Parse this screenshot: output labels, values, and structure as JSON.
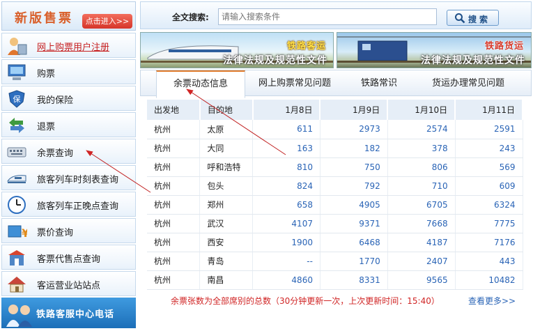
{
  "sidebar": {
    "header_title": "新版售票",
    "enter_label": "点击进入>>",
    "items": [
      {
        "label": "网上购票用户注册",
        "icon": "user-register-icon"
      },
      {
        "label": "购票",
        "icon": "computer-icon"
      },
      {
        "label": "我的保险",
        "icon": "shield-icon"
      },
      {
        "label": "退票",
        "icon": "return-arrow-icon"
      },
      {
        "label": "余票查询",
        "icon": "keyboard-icon"
      },
      {
        "label": "旅客列车时刻表查询",
        "icon": "train-icon"
      },
      {
        "label": "旅客列车正晚点查询",
        "icon": "clock-icon"
      },
      {
        "label": "票价查询",
        "icon": "price-icon"
      },
      {
        "label": "客票代售点查询",
        "icon": "store-icon"
      },
      {
        "label": "客运营业站站点",
        "icon": "house-icon"
      }
    ],
    "banner_text": "铁路客服中心电话"
  },
  "search": {
    "label": "全文搜索:",
    "placeholder": "请输入搜索条件",
    "button_label": "搜索"
  },
  "banners": [
    {
      "caption_top": "铁路客运",
      "caption_bottom": "法律法规及规范性文件"
    },
    {
      "caption_top": "铁路货运",
      "caption_bottom": "法律法规及规范性文件"
    }
  ],
  "tabs": [
    "余票动态信息",
    "网上购票常见问题",
    "铁路常识",
    "货运办理常见问题"
  ],
  "table": {
    "headers": [
      "出发地",
      "目的地",
      "1月8日",
      "1月9日",
      "1月10日",
      "1月11日"
    ],
    "rows": [
      [
        "杭州",
        "太原",
        "611",
        "2973",
        "2574",
        "2591"
      ],
      [
        "杭州",
        "大同",
        "163",
        "182",
        "378",
        "243"
      ],
      [
        "杭州",
        "呼和浩特",
        "810",
        "750",
        "806",
        "569"
      ],
      [
        "杭州",
        "包头",
        "824",
        "792",
        "710",
        "609"
      ],
      [
        "杭州",
        "郑州",
        "658",
        "4905",
        "6705",
        "6324"
      ],
      [
        "杭州",
        "武汉",
        "4107",
        "9371",
        "7668",
        "7775"
      ],
      [
        "杭州",
        "西安",
        "1900",
        "6468",
        "4187",
        "7176"
      ],
      [
        "杭州",
        "青岛",
        "--",
        "1770",
        "2407",
        "443"
      ],
      [
        "杭州",
        "南昌",
        "4860",
        "8331",
        "9565",
        "10482"
      ]
    ]
  },
  "footer": {
    "note": "余票张数为全部席别的总数（30分钟更新一次，上次更新时间：15:40）",
    "more_link": "查看更多>>"
  },
  "colors": {
    "accent_red": "#d02525",
    "link_blue": "#2a64b6",
    "tab_active_border": "#e07a2a"
  }
}
